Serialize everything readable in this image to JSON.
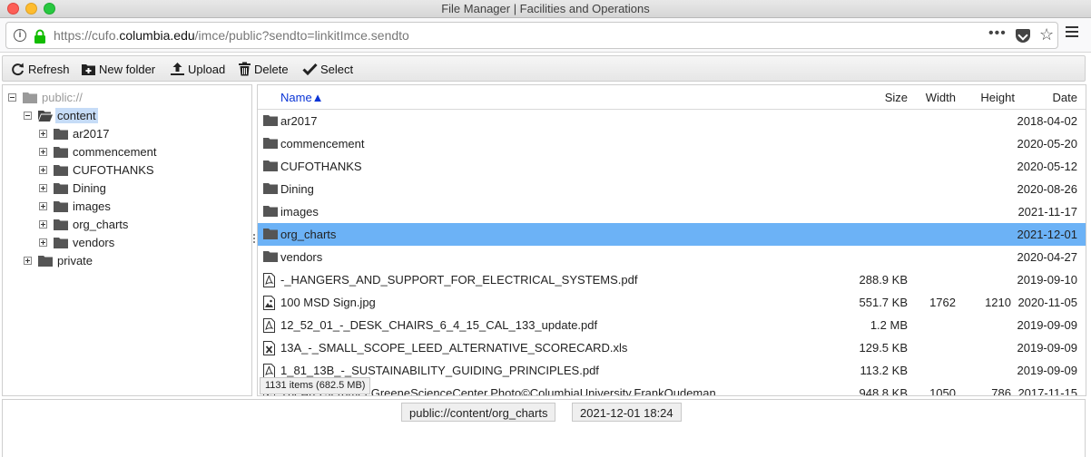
{
  "window": {
    "title": "File Manager | Facilities and Operations"
  },
  "urlbar": {
    "url_prefix": "https://cufo.",
    "url_domain": "columbia.edu",
    "url_suffix": "/imce/public?sendto=linkitImce.sendto",
    "page_actions_label": "•••"
  },
  "toolbar": {
    "refresh": "Refresh",
    "new_folder": "New folder",
    "upload": "Upload",
    "delete": "Delete",
    "select": "Select"
  },
  "tree": {
    "root": "public://",
    "content": "content",
    "children": [
      "ar2017",
      "commencement",
      "CUFOTHANKS",
      "Dining",
      "images",
      "org_charts",
      "vendors"
    ],
    "private": "private"
  },
  "filelist": {
    "headers": {
      "name": "Name▲",
      "size": "Size",
      "width": "Width",
      "height": "Height",
      "date": "Date"
    },
    "rows": [
      {
        "type": "folder",
        "name": "ar2017",
        "size": "",
        "width": "",
        "height": "",
        "date": "2018-04-02"
      },
      {
        "type": "folder",
        "name": "commencement",
        "size": "",
        "width": "",
        "height": "",
        "date": "2020-05-20"
      },
      {
        "type": "folder",
        "name": "CUFOTHANKS",
        "size": "",
        "width": "",
        "height": "",
        "date": "2020-05-12"
      },
      {
        "type": "folder",
        "name": "Dining",
        "size": "",
        "width": "",
        "height": "",
        "date": "2020-08-26"
      },
      {
        "type": "folder",
        "name": "images",
        "size": "",
        "width": "",
        "height": "",
        "date": "2021-11-17"
      },
      {
        "type": "folder",
        "name": "org_charts",
        "size": "",
        "width": "",
        "height": "",
        "date": "2021-12-01",
        "selected": true
      },
      {
        "type": "folder",
        "name": "vendors",
        "size": "",
        "width": "",
        "height": "",
        "date": "2020-04-27"
      },
      {
        "type": "pdf",
        "name": "-_HANGERS_AND_SUPPORT_FOR_ELECTRICAL_SYSTEMS.pdf",
        "size": "288.9 KB",
        "width": "",
        "height": "",
        "date": "2019-09-10"
      },
      {
        "type": "image",
        "name": "100 MSD Sign.jpg",
        "size": "551.7 KB",
        "width": "1762",
        "height": "1210",
        "date": "2020-11-05"
      },
      {
        "type": "pdf",
        "name": "12_52_01_-_DESK_CHAIRS_6_4_15_CAL_133_update.pdf",
        "size": "1.2 MB",
        "width": "",
        "height": "",
        "date": "2019-09-09"
      },
      {
        "type": "xls",
        "name": "13A_-_SMALL_SCOPE_LEED_ALTERNATIVE_SCORECARD.xls",
        "size": "129.5 KB",
        "width": "",
        "height": "",
        "date": "2019-09-09"
      },
      {
        "type": "pdf",
        "name": "1_81_13B_-_SUSTAINABILITY_GUIDING_PRINCIPLES.pdf",
        "size": "113.2 KB",
        "width": "",
        "height": "",
        "date": "2019-09-09"
      },
      {
        "type": "image",
        "name": "TheArts.JeromeLGreeneScienceCenter.Photo©ColumbiaUniversity.FrankOudeman",
        "size": "948.8 KB",
        "width": "1050",
        "height": "786",
        "date": "2017-11-15"
      }
    ],
    "items_count": "1131 items (682.5 MB)"
  },
  "statusbar": {
    "path": "public://content/org_charts",
    "datetime": "2021-12-01 18:24"
  },
  "colors": {
    "selection_row": "#6cb2f6",
    "tree_selection": "#c6dcf7",
    "sort_header": "#0b35d6",
    "lock_green": "#12bc00"
  }
}
